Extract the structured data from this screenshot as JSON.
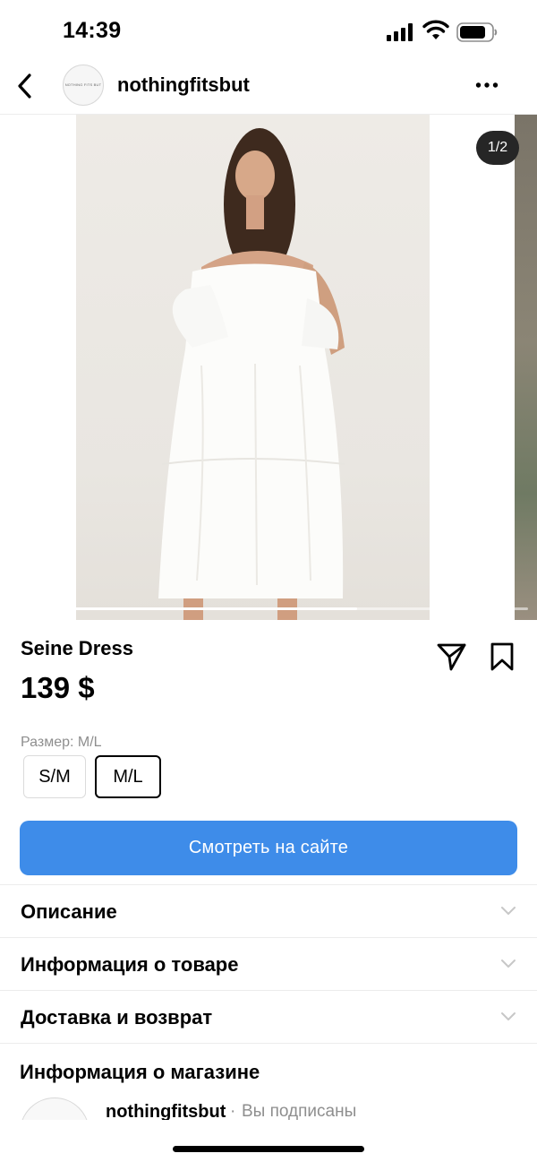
{
  "status_bar": {
    "time": "14:39"
  },
  "header": {
    "username": "nothingfitsbut",
    "avatar_text": "NOTHING FITS BUT"
  },
  "carousel": {
    "counter": "1/2",
    "progress": 0.67
  },
  "product": {
    "title": "Seine Dress",
    "price": "139 $"
  },
  "size": {
    "label": "Размер: M/L",
    "options": [
      "S/M",
      "M/L"
    ],
    "selected": "M/L"
  },
  "cta": {
    "label": "Смотреть на сайте",
    "color": "#3e8ce9"
  },
  "accordion": [
    {
      "label": "Описание"
    },
    {
      "label": "Информация о товаре"
    },
    {
      "label": "Доставка и возврат"
    }
  ],
  "store": {
    "heading": "Информация о магазине",
    "name": "nothingfitsbut",
    "separator": "·",
    "status": "Вы подписаны"
  },
  "icons": [
    "chevron-left-icon",
    "more-icon",
    "share-icon",
    "bookmark-icon",
    "chevron-down-icon",
    "signal-icon",
    "wifi-icon",
    "battery-icon"
  ]
}
